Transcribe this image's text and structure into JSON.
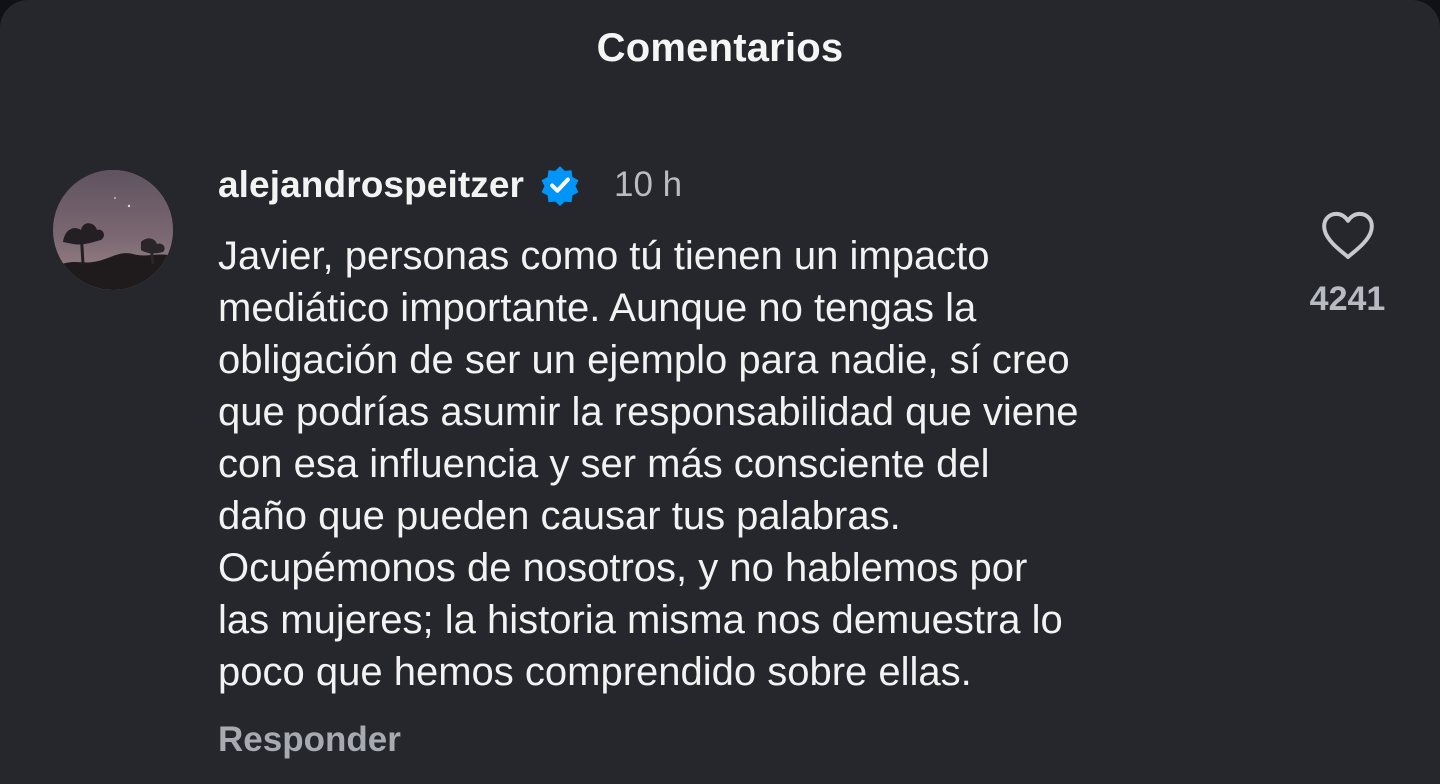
{
  "header": {
    "title": "Comentarios"
  },
  "comment": {
    "avatar_icon": "profile-avatar",
    "username": "alejandrospeitzer",
    "verified_icon": "verified-badge-icon",
    "timestamp": "10 h",
    "text": "Javier, personas como tú tienen un impacto\nmediático importante. Aunque no tengas la\nobligación de ser un ejemplo para nadie, sí creo\nque podrías asumir la responsabilidad que viene\ncon esa influencia y ser más consciente del\ndaño que pueden causar tus palabras.\nOcupémonos de nosotros, y no hablemos por\nlas mujeres; la historia misma nos demuestra lo\npoco que hemos comprendido sobre ellas.",
    "reply_label": "Responder",
    "like_icon": "heart-icon",
    "like_count": "4241"
  },
  "colors": {
    "background": "#25272d",
    "verified_blue": "#0095f6",
    "muted_text": "#b8bbc2"
  }
}
